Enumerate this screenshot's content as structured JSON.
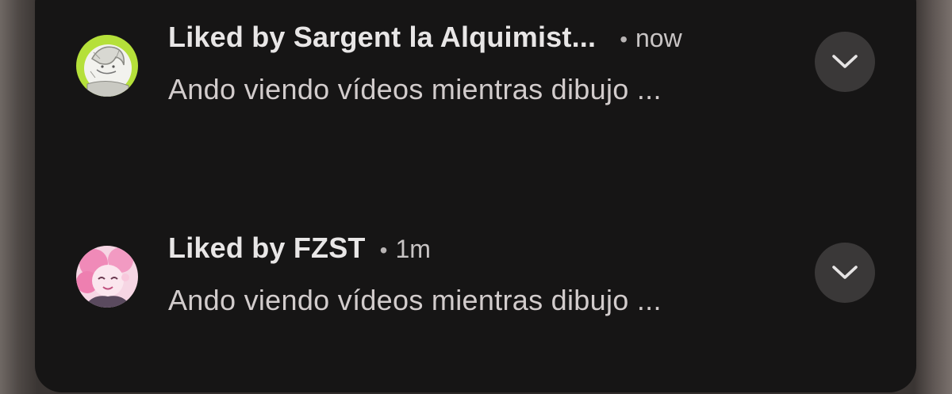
{
  "notifications": [
    {
      "title": "Liked by Sargent la Alquimist...",
      "separator": "•",
      "time": "now",
      "body": "Ando viendo vídeos mientras dibujo ...",
      "avatar_icon": "sketch-avatar-icon",
      "avatar_color": "#b5e03a"
    },
    {
      "title": "Liked by FZST",
      "separator": "•",
      "time": "1m",
      "body": "Ando viendo vídeos mientras dibujo ...",
      "avatar_icon": "pink-character-avatar-icon",
      "avatar_color": "#f2a6c8"
    }
  ],
  "colors": {
    "panel": "#161515",
    "title": "#e8e6e6",
    "body": "#d2cccc",
    "button": "#3a3838"
  }
}
